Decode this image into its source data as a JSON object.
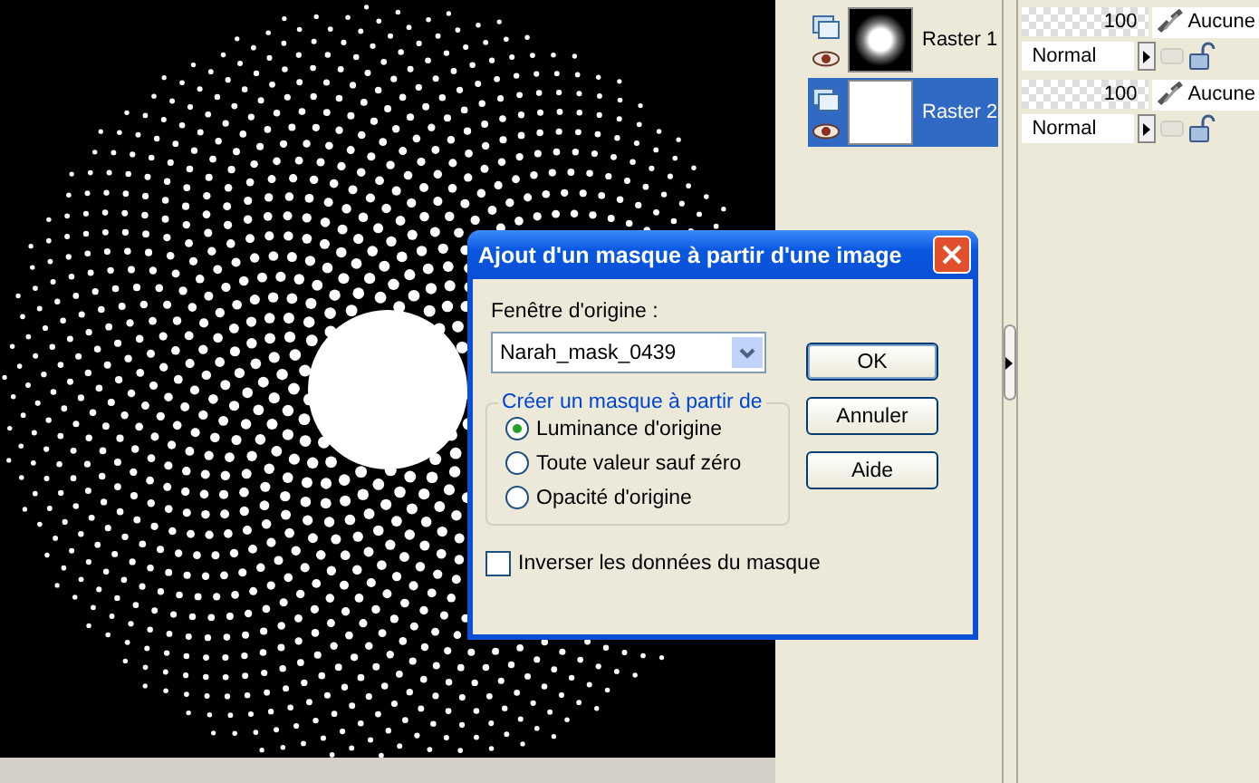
{
  "layers": [
    {
      "name": "Raster 1",
      "kind": "glow",
      "selected": false,
      "opacity": "100",
      "blend": "Normal",
      "mask": "Aucune"
    },
    {
      "name": "Raster 2",
      "kind": "blank",
      "selected": true,
      "opacity": "100",
      "blend": "Normal",
      "mask": "Aucune"
    }
  ],
  "dialog": {
    "title": "Ajout d'un masque à partir d'une image",
    "source_label": "Fenêtre d'origine :",
    "source_value": "Narah_mask_0439",
    "group_label": "Créer un masque à partir de",
    "options": [
      {
        "label": "Luminance d'origine",
        "selected": true
      },
      {
        "label": "Toute valeur sauf zéro",
        "selected": false
      },
      {
        "label": "Opacité d'origine",
        "selected": false
      }
    ],
    "invert": {
      "label": "Inverser les données du masque",
      "checked": false
    },
    "buttons": [
      "OK",
      "Annuler",
      "Aide"
    ]
  }
}
